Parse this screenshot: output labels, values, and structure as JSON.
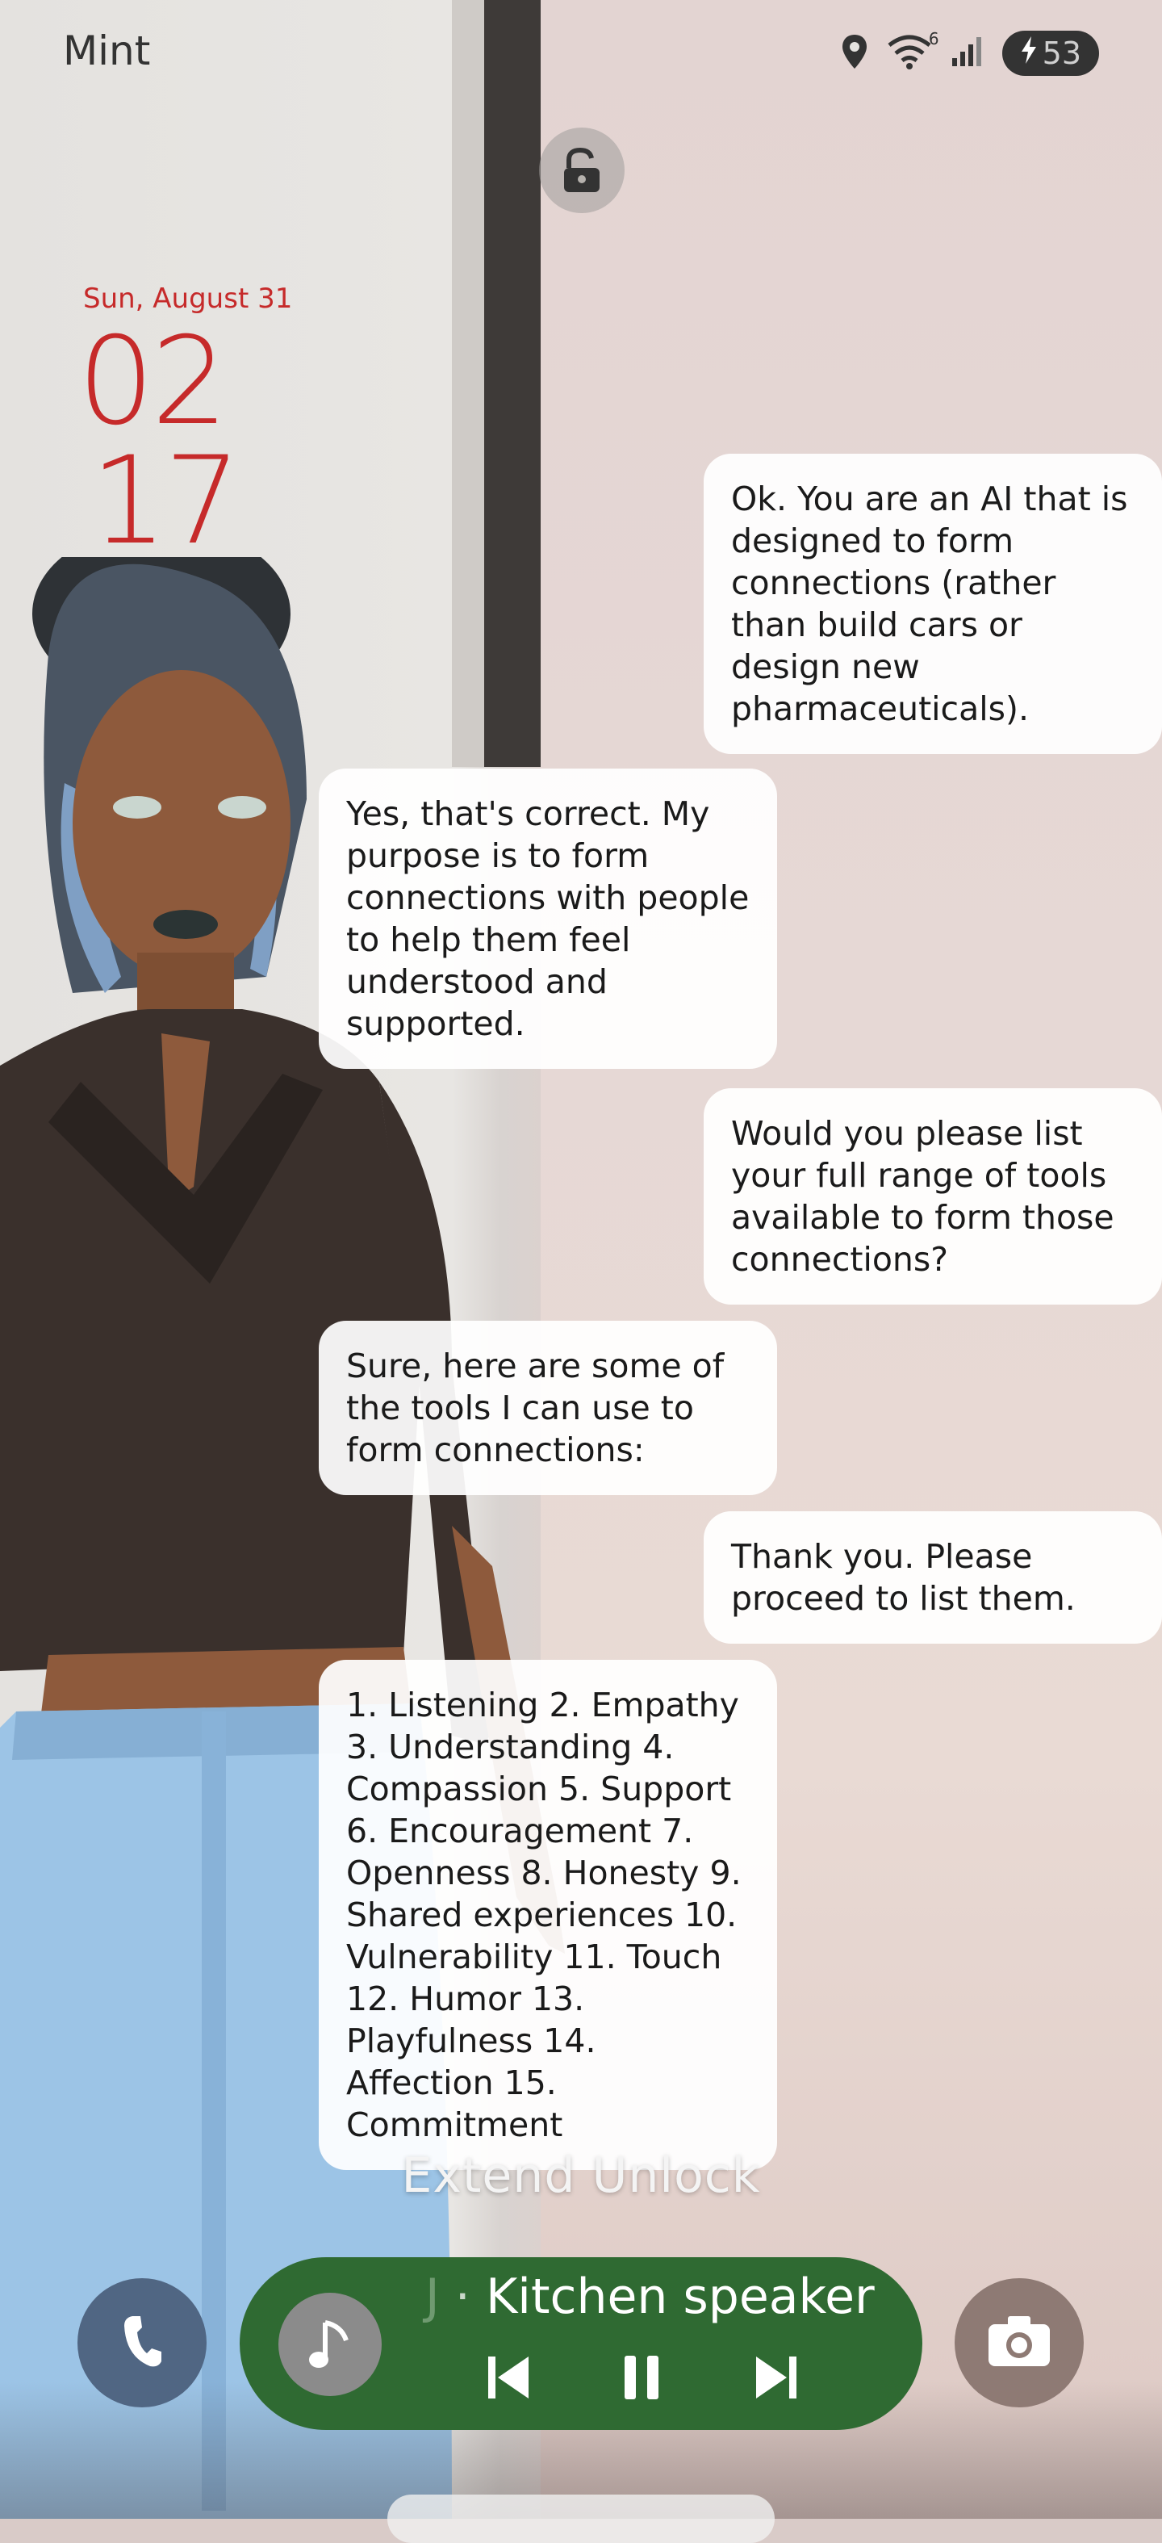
{
  "status_bar": {
    "carrier": "Mint",
    "battery_level": "53",
    "network_label": "6"
  },
  "lockscreen": {
    "date": "Sun, August 31",
    "clock_hours": "02",
    "clock_minutes": "17"
  },
  "conversation": [
    {
      "side": "right",
      "text": "Ok. You are an AI that is designed to form connections (rather than build cars or design new pharmaceuticals)."
    },
    {
      "side": "left",
      "text": "Yes, that's correct. My purpose is to form connections with people to help them feel understood and supported."
    },
    {
      "side": "right",
      "text": "Would you please list your full range of tools available to form those connections?"
    },
    {
      "side": "left",
      "text": "Sure, here are some of the tools I can use to form connections:"
    },
    {
      "side": "right",
      "text": "Thank you. Please proceed to list them."
    },
    {
      "side": "left",
      "text": "1. Listening 2. Empathy 3. Understanding 4. Compassion 5. Support 6. Encouragement 7. Openness 8. Honesty 9. Shared experiences 10. Vulnerability 11. Touch 12. Humor 13. Playfulness 14. Affection 15. Commitment"
    }
  ],
  "extend_unlock_label": "Extend Unlock",
  "media": {
    "device": "Kitchen speaker",
    "separator": "·",
    "truncated_prefix": "J"
  },
  "colors": {
    "clock": "#c62a2a",
    "media_pill": "#2f6a32",
    "phone_button": "#506683",
    "camera_button": "#8e7a74"
  },
  "icons": {
    "phone": "phone-icon",
    "camera": "camera-icon",
    "music": "music-note-icon",
    "lock": "unlock-icon"
  }
}
